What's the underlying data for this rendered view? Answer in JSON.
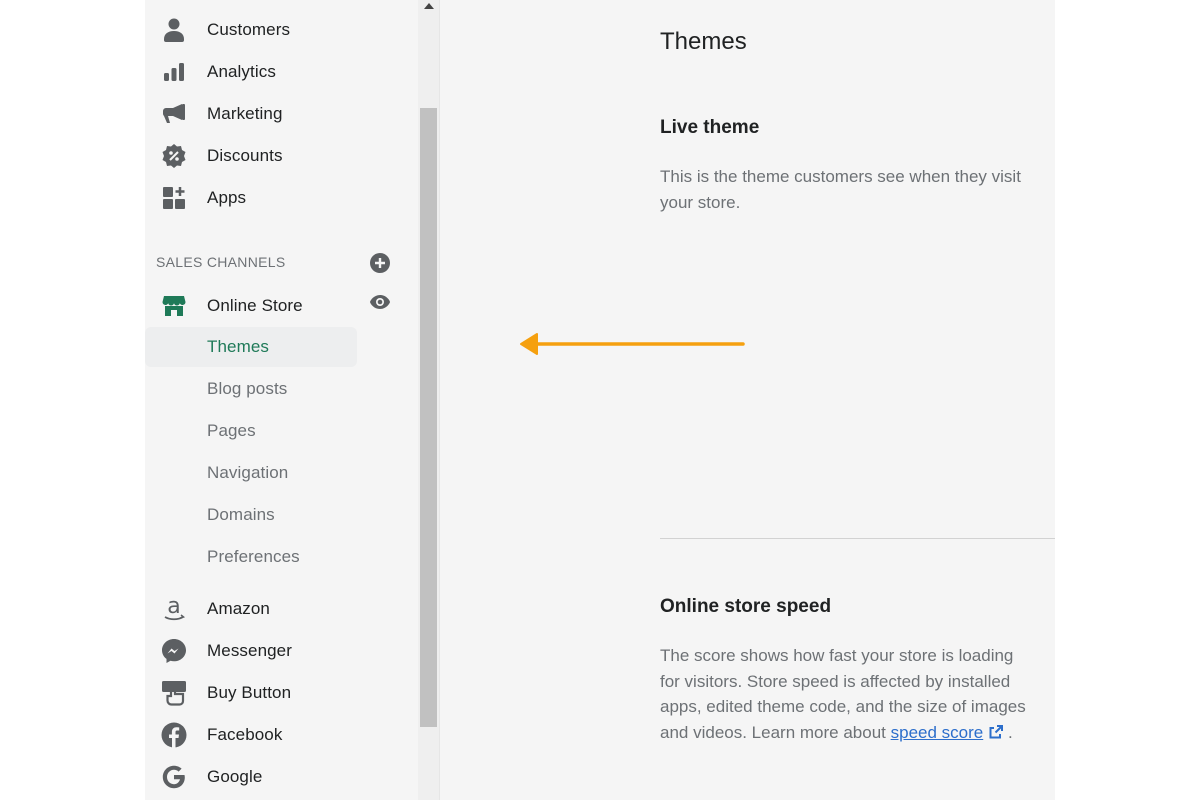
{
  "sidebar": {
    "main_items": [
      {
        "label": "Customers",
        "icon": "person-icon"
      },
      {
        "label": "Analytics",
        "icon": "bar-chart-icon"
      },
      {
        "label": "Marketing",
        "icon": "megaphone-icon"
      },
      {
        "label": "Discounts",
        "icon": "discount-badge-icon"
      },
      {
        "label": "Apps",
        "icon": "apps-grid-icon"
      }
    ],
    "sales_channels_header": "SALES CHANNELS",
    "online_store": {
      "label": "Online Store",
      "icon": "storefront-icon"
    },
    "online_store_subitems": [
      {
        "label": "Themes",
        "active": true
      },
      {
        "label": "Blog posts",
        "active": false
      },
      {
        "label": "Pages",
        "active": false
      },
      {
        "label": "Navigation",
        "active": false
      },
      {
        "label": "Domains",
        "active": false
      },
      {
        "label": "Preferences",
        "active": false
      }
    ],
    "other_channels": [
      {
        "label": "Amazon",
        "icon": "amazon-icon"
      },
      {
        "label": "Messenger",
        "icon": "messenger-icon"
      },
      {
        "label": "Buy Button",
        "icon": "buy-button-icon"
      },
      {
        "label": "Facebook",
        "icon": "facebook-icon"
      },
      {
        "label": "Google",
        "icon": "google-icon"
      }
    ]
  },
  "main": {
    "page_title": "Themes",
    "live_theme": {
      "title": "Live theme",
      "description": "This is the theme customers see when they visit your store."
    },
    "store_speed": {
      "title": "Online store speed",
      "description": "The score shows how fast your store is loading for visitors. Store speed is affected by installed apps, edited theme code, and the size of images and videos. Learn more about ",
      "link_text": "speed score",
      "suffix": " ."
    }
  },
  "annotation": {
    "arrow_color": "#f5a00f",
    "points_to": "Themes"
  },
  "colors": {
    "active_green": "#1f7a58",
    "link_blue": "#2c6ecb",
    "icon_gray": "#5c5f62"
  }
}
